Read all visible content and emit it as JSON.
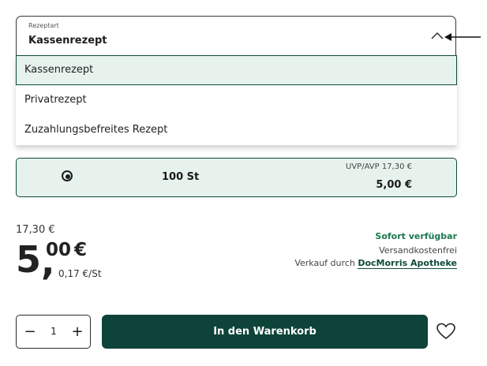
{
  "prescription": {
    "label": "Rezeptart",
    "value": "Kassenrezept",
    "options": [
      "Kassenrezept",
      "Privatrezept",
      "Zuzahlungsbefreites Rezept"
    ],
    "selected_index": 0
  },
  "pack": {
    "quantity": "100 St",
    "uvp": "UVP/AVP 17,30 €",
    "price": "5,00 €"
  },
  "price": {
    "old": "17,30 €",
    "integer": "5",
    "comma": ",",
    "decimals": "00",
    "currency": "€",
    "unit_price": "0,17 €/St"
  },
  "availability": {
    "status": "Sofort verfügbar",
    "shipping": "Versandkostenfrei",
    "seller_prefix": "Verkauf durch",
    "seller_name": "DocMorris Apotheke"
  },
  "cart": {
    "quantity": "1",
    "minus": "−",
    "plus": "+",
    "button_label": "In den Warenkorb"
  },
  "colors": {
    "brand": "#0d4338",
    "available": "#1a7a4f",
    "selected_bg": "#e7f2ed"
  },
  "icons": [
    "chevron-up-icon",
    "arrow-left-icon",
    "radio-checked-icon",
    "minus-icon",
    "plus-icon",
    "heart-icon"
  ]
}
